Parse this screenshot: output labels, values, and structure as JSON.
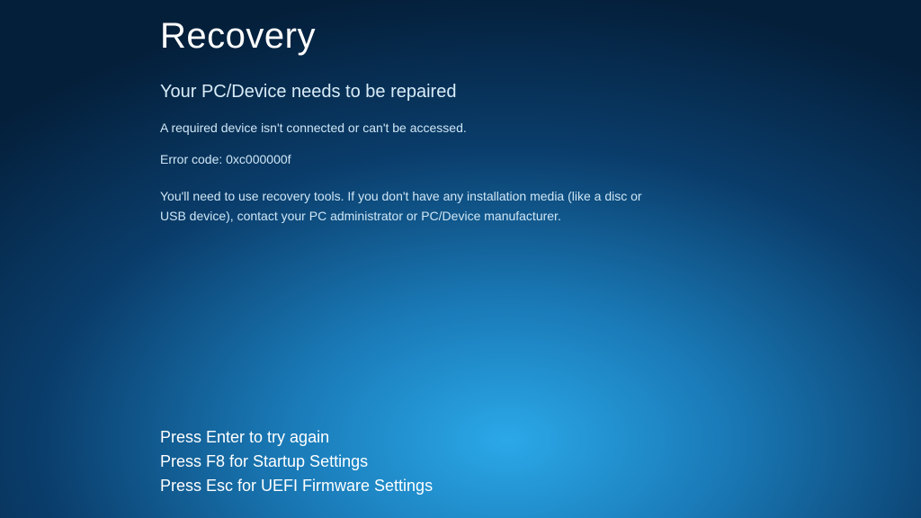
{
  "header": {
    "title": "Recovery",
    "subtitle": "Your PC/Device needs to be repaired"
  },
  "body": {
    "message": "A required device isn't connected or can't be accessed.",
    "error_code": "Error code: 0xc000000f",
    "instructions": "You'll need to use recovery tools. If you don't have any installation media (like a disc or USB device), contact your PC administrator or PC/Device manufacturer."
  },
  "footer": {
    "line1": "Press Enter to try again",
    "line2": "Press F8 for Startup Settings",
    "line3": "Press Esc for UEFI Firmware Settings"
  }
}
